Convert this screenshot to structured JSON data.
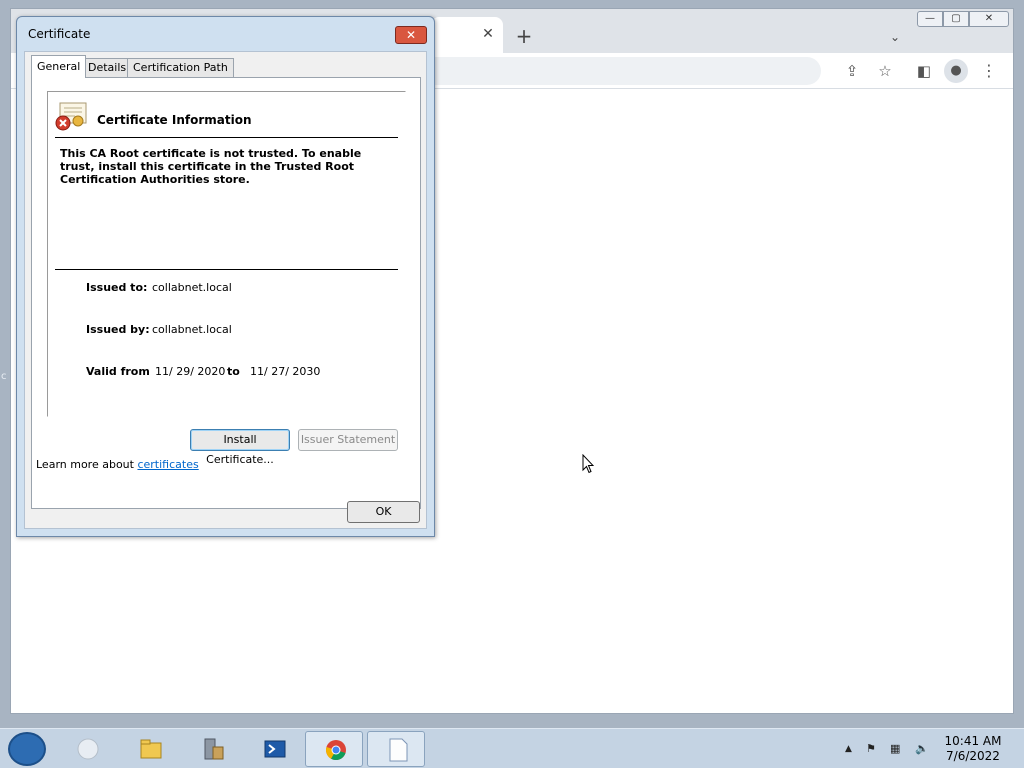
{
  "browser": {
    "tab_close": "✕",
    "new_tab": "+",
    "tab_list": "⌄",
    "window_minimize": "—",
    "window_maximize": "▢",
    "window_close": "✕",
    "toolbar_icons": [
      "share-icon",
      "star-icon",
      "side-panel-icon",
      "profile-icon",
      "menu-icon"
    ]
  },
  "dialog": {
    "title": "Certificate",
    "close_label": "✕",
    "tabs": [
      {
        "label": "General",
        "selected": true
      },
      {
        "label": "Details",
        "selected": false
      },
      {
        "label": "Certification Path",
        "selected": false
      }
    ],
    "info_heading": "Certificate Information",
    "warning_text": "This CA Root certificate is not trusted. To enable trust, install this certificate in the Trusted Root Certification Authorities store.",
    "fields": {
      "issued_to_label": "Issued to:",
      "issued_to_value": "collabnet.local",
      "issued_by_label": "Issued by:",
      "issued_by_value": "collabnet.local",
      "valid_from_label": "Valid from",
      "valid_from_value": "11/ 29/ 2020",
      "valid_to_label": "to",
      "valid_to_value": "11/ 27/ 2030"
    },
    "buttons": {
      "install": "Install Certificate...",
      "issuer_statement": "Issuer Statement",
      "ok": "OK"
    },
    "learn_more_prefix": "Learn more about ",
    "learn_more_link": "certificates"
  },
  "taskbar": {
    "items": [
      "windows-start-icon",
      "blank-app-icon",
      "file-explorer-icon",
      "server-manager-icon",
      "powershell-icon",
      "chrome-icon",
      "document-icon"
    ],
    "tray_up": "▲",
    "clock_time": "10:41 AM",
    "clock_date": "7/6/2022"
  },
  "colors": {
    "dialog_frame": "#cfe0f0",
    "close_button": "#d9573f",
    "link": "#0066cc",
    "taskbar": "#c4d3e3"
  }
}
